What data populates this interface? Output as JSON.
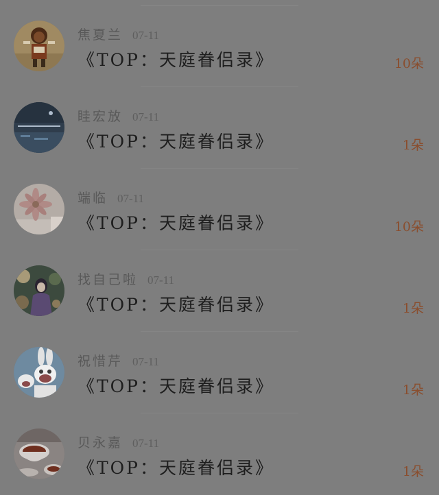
{
  "items": [
    {
      "name": "焦夏兰",
      "date": "07-11",
      "title": "《TOP：天庭眷侣录》",
      "count": "10朵",
      "avatar_icon": "cartoon-character-avatar",
      "avatar_colors": {
        "bg": "#a08a62",
        "accent": "#7a3a1e",
        "light": "#d8cbb0"
      }
    },
    {
      "name": "眭宏放",
      "date": "07-11",
      "title": "《TOP：天庭眷侣录》",
      "count": "1朵",
      "avatar_icon": "night-sky-avatar",
      "avatar_colors": {
        "bg": "#2f3d4c",
        "accent": "#5f7d98",
        "light": "#aebccc"
      }
    },
    {
      "name": "端临",
      "date": "07-11",
      "title": "《TOP：天庭眷侣录》",
      "count": "10朵",
      "avatar_icon": "flower-avatar",
      "avatar_colors": {
        "bg": "#b4aca6",
        "accent": "#b08a86",
        "light": "#d8d0ca"
      }
    },
    {
      "name": "找自己啦",
      "date": "07-11",
      "title": "《TOP：天庭眷侣录》",
      "count": "1朵",
      "avatar_icon": "anime-girl-avatar",
      "avatar_colors": {
        "bg": "#3c4a3e",
        "accent": "#5a4a72",
        "light": "#a89a78"
      }
    },
    {
      "name": "祝惜芹",
      "date": "07-11",
      "title": "《TOP：天庭眷侣录》",
      "count": "1朵",
      "avatar_icon": "rabbid-cartoon-avatar",
      "avatar_colors": {
        "bg": "#6e8aa0",
        "accent": "#e2e2e2",
        "light": "#f0f0f0"
      }
    },
    {
      "name": "贝永嘉",
      "date": "07-11",
      "title": "《TOP：天庭眷侣录》",
      "count": "1朵",
      "avatar_icon": "teacup-avatar",
      "avatar_colors": {
        "bg": "#8a8482",
        "accent": "#6e2e1e",
        "light": "#d4cfcc"
      }
    }
  ]
}
